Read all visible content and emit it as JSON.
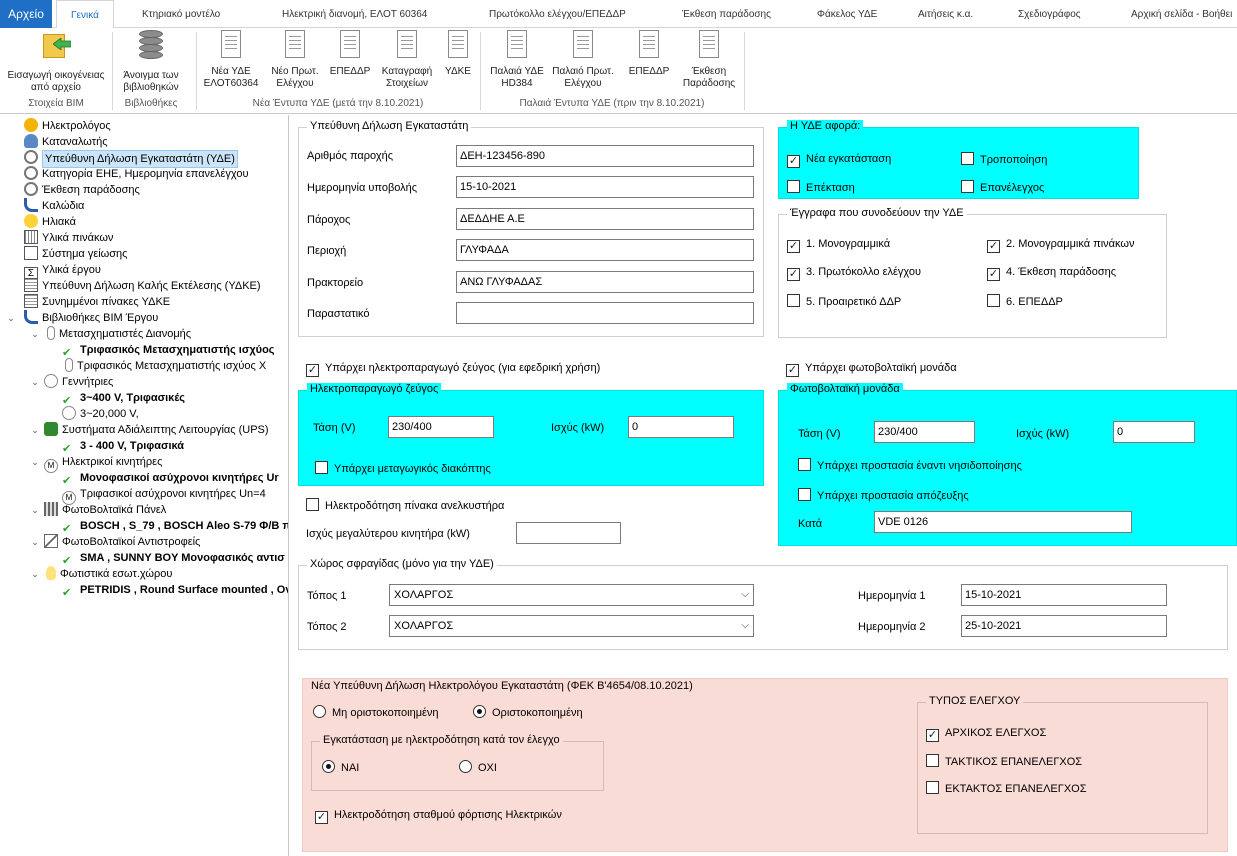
{
  "ribbon": {
    "file_tab": "Αρχείο",
    "tabs": [
      "Γενικά",
      "Κτηριακό μοντέλο",
      "Ηλεκτρική διανομή, ΕΛΟΤ 60364",
      "Πρωτόκολλο ελέγχου/ΕΠΕΔΔΡ",
      "Έκθεση παράδοσης",
      "Φάκελος ΥΔΕ",
      "Αιτήσεις κ.α.",
      "Σχεδιογράφος",
      "Αρχική σελίδα - Βοήθει"
    ],
    "buttons": {
      "import_family": "Εισαγωγή οικογένειας από αρχείο",
      "open_libraries": "Άνοιγμα των βιβλιοθηκών",
      "new_yde": "Νέα ΥΔΕ ΕΛΟΤ60364",
      "new_protocol": "Νέο Πρωτ. Ελέγχου",
      "epeddr_new": "ΕΠΕΔΔΡ",
      "record_elements": "Καταγραφή Στοιχείων",
      "ydke": "ΥΔΚΕ",
      "old_yde": "Παλαιά ΥΔΕ HD384",
      "old_protocol": "Παλαιό Πρωτ. Ελέγχου",
      "epeddr_old": "ΕΠΕΔΔΡ",
      "delivery_report": "Έκθεση Παράδοσης"
    },
    "groups": {
      "bim": "Στοιχεία BIM",
      "libraries": "Βιβλιοθήκες",
      "new_forms": "Νέα Έντυπα ΥΔΕ (μετά την 8.10.2021)",
      "old_forms": "Παλαιά Έντυπα ΥΔΕ (πριν την 8.10.2021)"
    }
  },
  "tree": {
    "items": [
      "Ηλεκτρολόγος",
      "Καταναλωτής",
      "Υπεύθυνη Δήλωση Εγκαταστάτη (ΥΔΕ)",
      "Κατηγορία ΕΗΕ, Ημερομηνία επανελέγχου",
      "Έκθεση παράδοσης",
      "Καλώδια",
      "Ηλιακά",
      "Υλικά πινάκων",
      "Σύστημα γείωσης",
      "Υλικά έργου",
      "Υπεύθυνη Δήλωση Καλής Εκτέλεσης (ΥΔΚΕ)",
      "Συνημμένοι πίνακες ΥΔΚΕ",
      "Βιβλιοθήκες BIM Έργου",
      "Μετασχηματιστές Διανομής",
      "Τριφασικός Μετασχηματιστής ισχύος",
      "Τριφασικός Μετασχηματιστής ισχύος Χ",
      "Γεννήτριες",
      "3~400 V, Τριφασικές",
      "3~20,000 V,",
      "Συστήματα Αδιάλειπτης Λειτουργίας (UPS)",
      "3 - 400 V, Τριφασικά",
      "Ηλεκτρικοί κινητήρες",
      "Μονοφασικοί ασύχρονοι κινητήρες Ur",
      "Τριφασικοί ασύχρονοι κινητήρες Un=4",
      "ΦωτοΒολταϊκά Πάνελ",
      "BOSCH , S_79 , BOSCH Aleo S-79 Φ/Β πά",
      "ΦωτοΒολταϊκοί Αντιστροφείς",
      "SMA , SUNNY BOY Μονοφασικός αντισ",
      "Φωτιστικά εσωτ.χώρου",
      "PETRIDIS , Round Surface mounted , Ov"
    ]
  },
  "decl": {
    "title": "Υπεύθυνη Δήλωση Εγκαταστάτη",
    "supply_no_label": "Αριθμός παροχής",
    "supply_no": "ΔΕΗ-123456-890",
    "date_label": "Ημερομηνία υποβολής",
    "date": "15-10-2021",
    "provider_label": "Πάροχος",
    "provider": "ΔΕΔΔΗΕ Α.Ε",
    "region_label": "Περιοχή",
    "region": "ΓΛΥΦΑΔΑ",
    "agency_label": "Πρακτορείο",
    "agency": "ΑΝΩ ΓΛΥΦΑΔΑΣ",
    "doc_label": "Παραστατικό",
    "doc": ""
  },
  "concerns": {
    "title": "Η ΥΔΕ αφορά:",
    "new_install": "Νέα εγκατάσταση",
    "modification": "Τροποποίηση",
    "extension": "Επέκταση",
    "recheck": "Επανέλεγχος"
  },
  "attachments": {
    "title": "Έγγραφα που συνοδεύουν την ΥΔΕ",
    "a1": "1. Μονογραμμικά",
    "a2": "2. Μονογραμμικά πινάκων",
    "a3": "3. Πρωτόκολλο ελέγχου",
    "a4": "4. Έκθεση παράδοσης",
    "a5": "5. Προαιρετικό ΔΔΡ",
    "a6": "6. ΕΠΕΔΔΡ"
  },
  "generator": {
    "exists": "Υπάρχει ηλεκτροπαραγωγό ζεύγος (για εφεδρική χρήση)",
    "title": "Ηλεκτροπαραγωγό ζεύγος",
    "voltage_label": "Τάση (V)",
    "voltage": "230/400",
    "power_label": "Ισχύς (kW)",
    "power": "0",
    "switch": "Υπάρχει μεταγωγικός διακόπτης"
  },
  "pv": {
    "exists": "Υπάρχει φωτοβολταϊκή μονάδα",
    "title": "Φωτοβολταϊκή μονάδα",
    "voltage_label": "Τάση (V)",
    "voltage": "230/400",
    "power_label": "Ισχύς (kW)",
    "power": "0",
    "islanding": "Υπάρχει προστασία έναντι νησιδοποίησης",
    "decoupling": "Υπάρχει προστασία απόζευξης",
    "according_label": "Κατά",
    "according": "VDE 0126"
  },
  "elevator": {
    "panel": "Ηλεκτροδότηση πίνακα ανελκυστήρα",
    "motor_label": "Ισχύς μεγαλύτερου κινητήρα (kW)",
    "motor": ""
  },
  "seal": {
    "title": "Χώρος σφραγίδας (μόνο για την ΥΔΕ)",
    "place1_label": "Τόπος 1",
    "place1": "ΧΟΛΑΡΓΟΣ",
    "place2_label": "Τόπος 2",
    "place2": "ΧΟΛΑΡΓΟΣ",
    "date1_label": "Ημερομηνία 1",
    "date1": "15-10-2021",
    "date2_label": "Ημερομηνία 2",
    "date2": "25-10-2021"
  },
  "new_decl": {
    "title": "Νέα Υπεύθυνη Δήλωση Ηλεκτρολόγου Εγκαταστάτη (ΦΕΚ Β'4654/08.10.2021)",
    "not_final": "Μη οριστοκοποιημένη",
    "final": "Οριστοκοποιημένη",
    "powered_title": "Εγκατάσταση με ηλεκτροδότηση κατά τον έλεγχο",
    "yes": "ΝΑΙ",
    "no": "ΟΧΙ",
    "ev_charging": "Ηλεκτροδότηση σταθμού φόρτισης Ηλεκτρικών",
    "check_type_title": "ΤΥΠΟΣ ΕΛΕΓΧΟΥ",
    "initial": "ΑΡΧΙΚΟΣ ΕΛΕΓΧΟΣ",
    "periodic": "ΤΑΚΤΙΚΟΣ ΕΠΑΝΕΛΕΓΧΟΣ",
    "extraordinary": "ΕΚΤΑΚΤΟΣ ΕΠΑΝΕΛΕΓΧΟΣ"
  },
  "colors": {
    "cyan": "#00ffff",
    "pink": "#fadcd6",
    "accent": "#1e6fc5"
  }
}
